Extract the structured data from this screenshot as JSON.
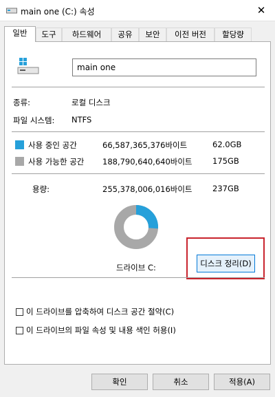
{
  "window": {
    "title": "main one (C:) 속성",
    "close_icon": "close-icon"
  },
  "tabs": [
    {
      "label": "일반",
      "active": true
    },
    {
      "label": "도구"
    },
    {
      "label": "하드웨어"
    },
    {
      "label": "공유"
    },
    {
      "label": "보안"
    },
    {
      "label": "이전 버전"
    },
    {
      "label": "할당량"
    }
  ],
  "general": {
    "drive_name": "main one",
    "type_label": "종류:",
    "type_value": "로컬 디스크",
    "fs_label": "파일 시스템:",
    "fs_value": "NTFS",
    "used": {
      "label": "사용 중인 공간",
      "bytes": "66,587,365,376바이트",
      "size": "62.0GB",
      "color": "#26a0da"
    },
    "free": {
      "label": "사용 가능한 공간",
      "bytes": "188,790,640,640바이트",
      "size": "175GB",
      "color": "#a8a8a8"
    },
    "capacity": {
      "label": "용량:",
      "bytes": "255,378,006,016바이트",
      "size": "237GB"
    },
    "used_fraction": 0.261,
    "drive_label": "드라이브 C:",
    "cleanup_button": "디스크 정리(D)"
  },
  "options": {
    "compress": "이 드라이브를 압축하여 디스크 공간 절약(C)",
    "index": "이 드라이브의 파일 속성 및 내용 색인 허용(I)"
  },
  "buttons": {
    "ok": "확인",
    "cancel": "취소",
    "apply": "적용(A)"
  }
}
